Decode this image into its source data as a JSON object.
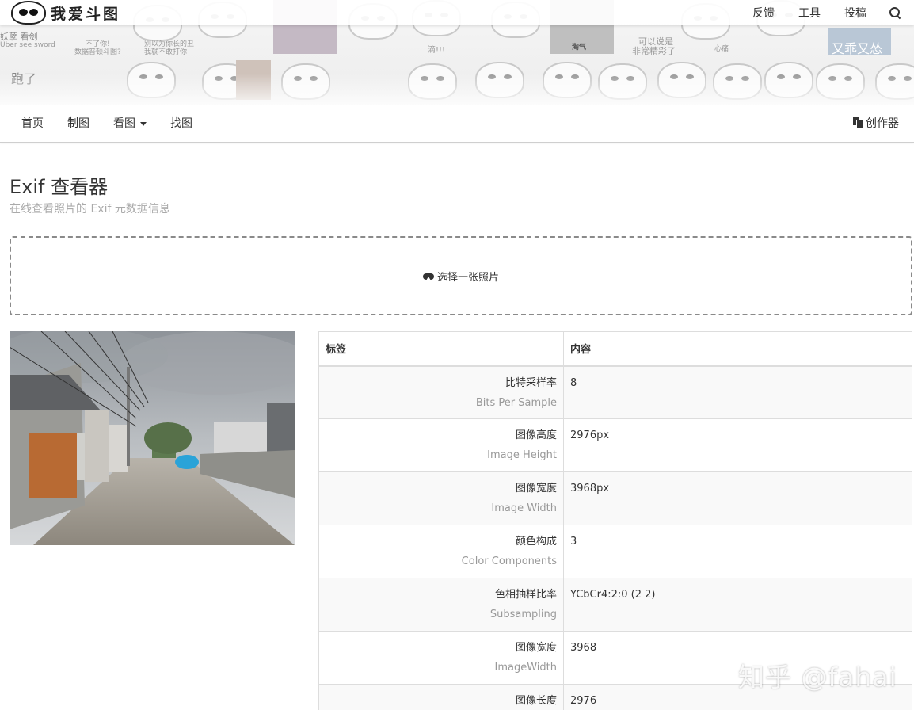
{
  "site": {
    "name": "我爱斗图"
  },
  "banner": {
    "captions": [
      "妖孽 看剑",
      "Uber see sword",
      "不了你!",
      "数据普顿斗图?",
      "别以为你长的丑",
      "我就不敢打你",
      "滴!!!",
      "淘气",
      "可以说是",
      "非常精彩了",
      "心痛",
      "又乖又怂",
      "跑了"
    ]
  },
  "top_links": {
    "feedback": "反馈",
    "tools": "工具",
    "submit": "投稿",
    "search_icon": "search-icon"
  },
  "nav": {
    "home": "首页",
    "make": "制图",
    "browse": "看图",
    "find": "找图",
    "creator": "创作器"
  },
  "page": {
    "title": "Exif 查看器",
    "subtitle": "在线查看照片的 Exif 元数据信息"
  },
  "upload": {
    "label": "选择一张照片",
    "icon": "cloud-upload-icon"
  },
  "table": {
    "headers": {
      "label": "标签",
      "content": "内容"
    },
    "rows": [
      {
        "zh": "比特采样率",
        "en": "Bits Per Sample",
        "value": "8"
      },
      {
        "zh": "图像高度",
        "en": "Image Height",
        "value": "2976px"
      },
      {
        "zh": "图像宽度",
        "en": "Image Width",
        "value": "3968px"
      },
      {
        "zh": "颜色构成",
        "en": "Color Components",
        "value": "3"
      },
      {
        "zh": "色相抽样比率",
        "en": "Subsampling",
        "value": "YCbCr4:2:0 (2 2)"
      },
      {
        "zh": "图像宽度",
        "en": "ImageWidth",
        "value": "3968"
      },
      {
        "zh": "图像长度",
        "en": "",
        "value": "2976"
      }
    ]
  },
  "watermark": "知乎 @fahai",
  "colors": {
    "border": "#dddddd",
    "stripe": "#f9f9f9",
    "muted": "#999999",
    "dash": "#8a8a8a"
  }
}
